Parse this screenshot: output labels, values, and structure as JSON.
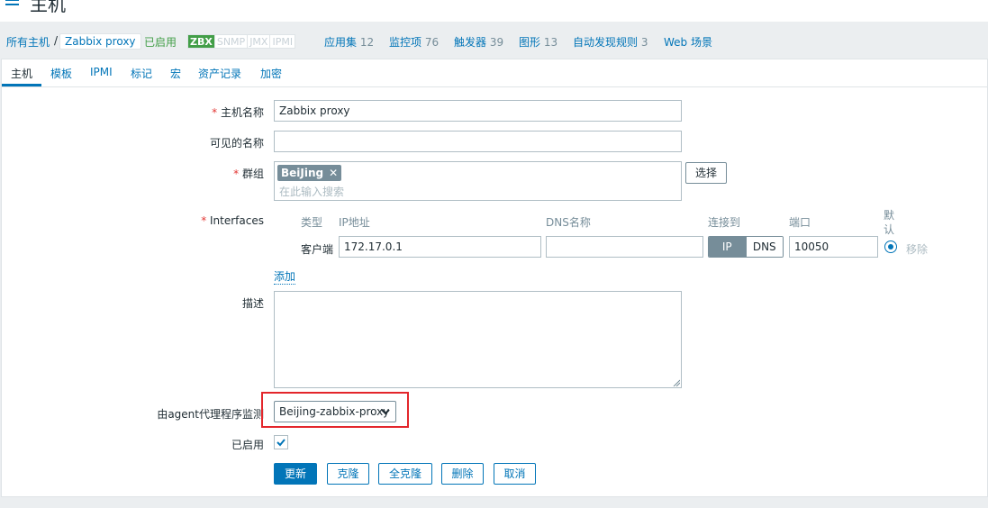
{
  "page": {
    "title": "主机"
  },
  "nav": {
    "all_hosts": "所有主机",
    "separator": "/",
    "current_host": "Zabbix proxy",
    "status": "已启用",
    "availability": [
      "ZBX",
      "SNMP",
      "JMX",
      "IPMI"
    ],
    "links": [
      {
        "label": "应用集",
        "count": "12"
      },
      {
        "label": "监控项",
        "count": "76"
      },
      {
        "label": "触发器",
        "count": "39"
      },
      {
        "label": "图形",
        "count": "13"
      },
      {
        "label": "自动发现规则",
        "count": "3"
      },
      {
        "label": "Web 场景",
        "count": ""
      }
    ]
  },
  "tabs": [
    "主机",
    "模板",
    "IPMI",
    "标记",
    "宏",
    "资产记录",
    "加密"
  ],
  "form": {
    "host_name": {
      "label": "主机名称",
      "value": "Zabbix proxy"
    },
    "visible_name": {
      "label": "可见的名称",
      "value": ""
    },
    "groups": {
      "label": "群组",
      "chip": "BeiJing",
      "chip_remove": "✕",
      "placeholder": "在此输入搜索",
      "select_button": "选择"
    },
    "interfaces": {
      "label": "Interfaces",
      "headers": {
        "type": "类型",
        "ip": "IP地址",
        "dns": "DNS名称",
        "connect": "连接到",
        "port": "端口",
        "default_line1": "默",
        "default_line2": "认"
      },
      "row": {
        "type": "客户端",
        "ip": "172.17.0.1",
        "dns": "",
        "connect_ip": "IP",
        "connect_dns": "DNS",
        "port": "10050",
        "remove": "移除"
      },
      "add": "添加"
    },
    "description": {
      "label": "描述",
      "value": ""
    },
    "proxy": {
      "label": "由agent代理程序监测",
      "value": "Beijing-zabbix-proxy"
    },
    "enabled": {
      "label": "已启用",
      "checked": true
    }
  },
  "actions": {
    "update": "更新",
    "clone": "克隆",
    "full_clone": "全克隆",
    "delete": "删除",
    "cancel": "取消"
  },
  "colors": {
    "accent": "#0275b8",
    "enabled_green": "#429e47",
    "required_red": "#e33734",
    "highlight": "#e3262b"
  }
}
